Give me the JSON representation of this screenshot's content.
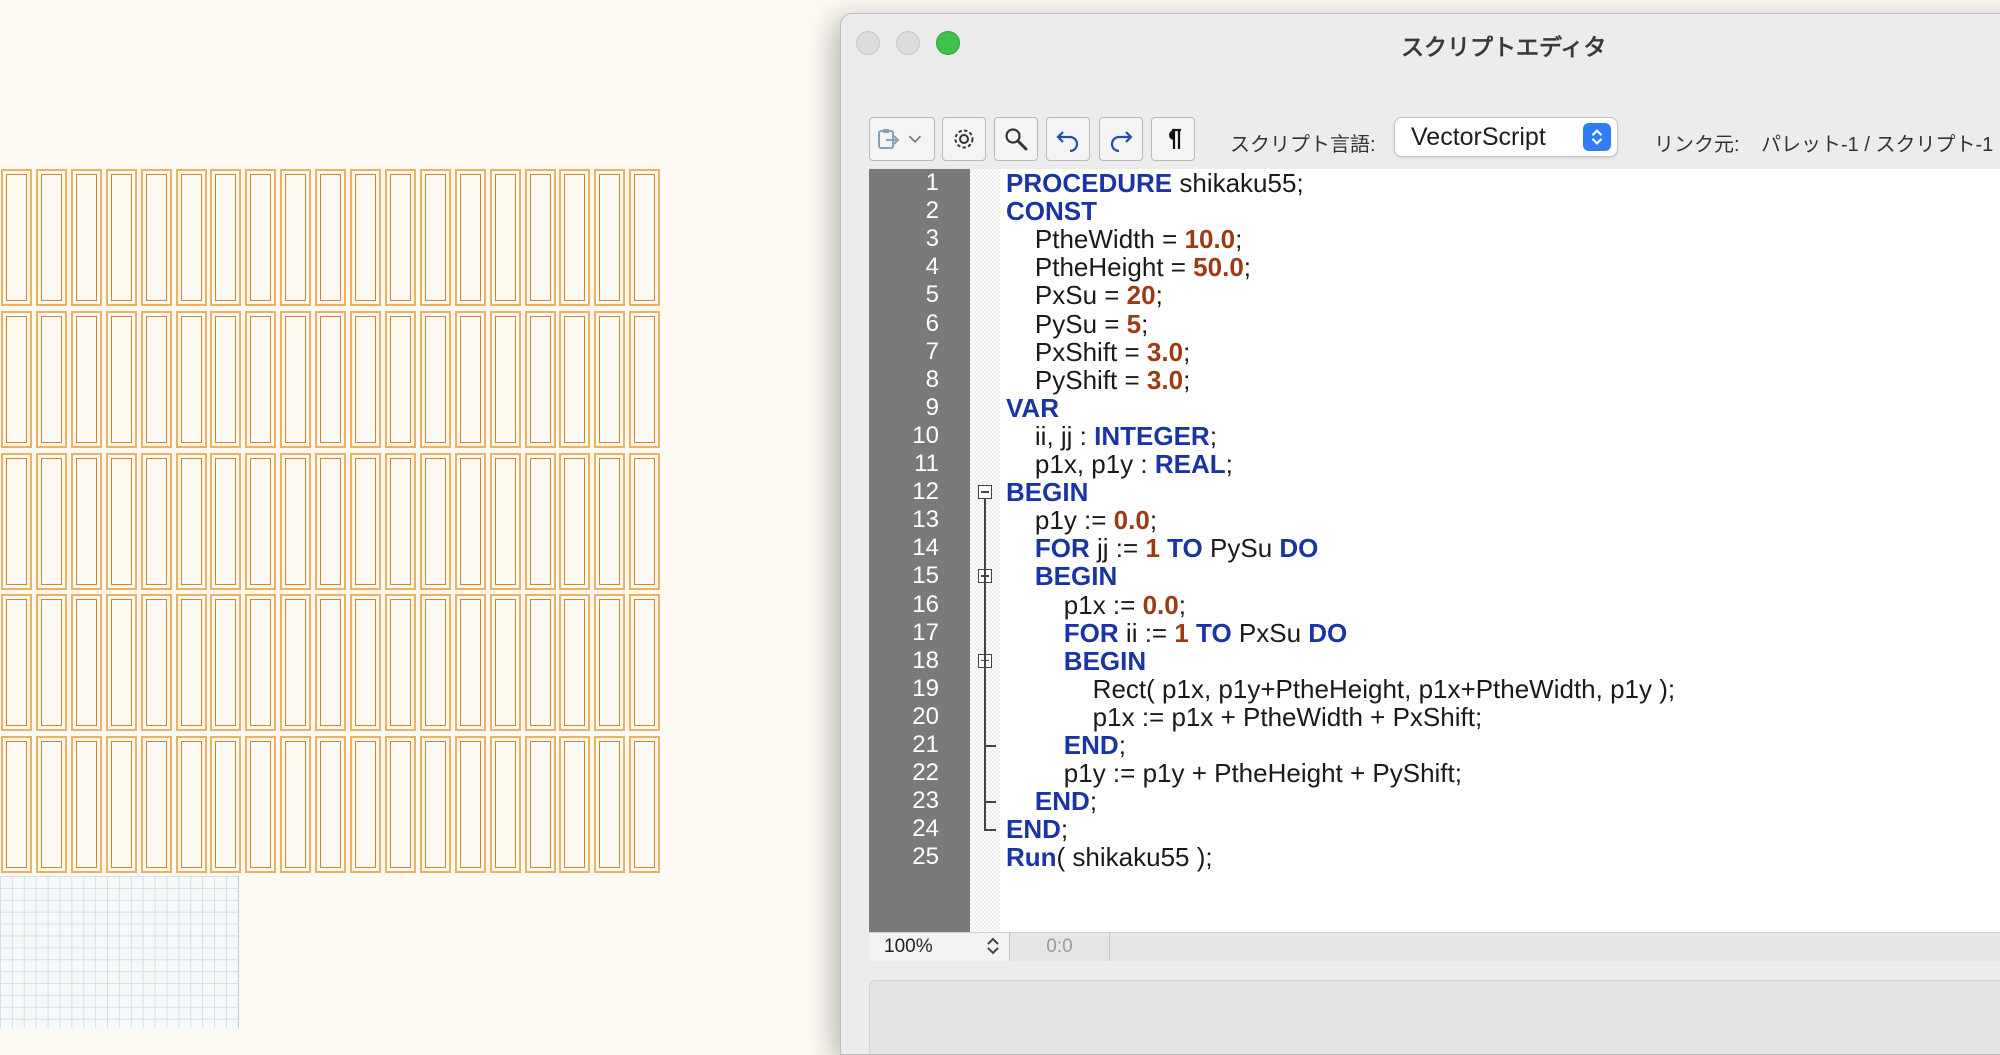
{
  "window": {
    "title": "スクリプトエディタ"
  },
  "toolbar": {
    "buttons": [
      {
        "name": "clipboard-menu-button",
        "icon": "clipboard-icon"
      },
      {
        "name": "settings-button",
        "icon": "gear-icon"
      },
      {
        "name": "find-button",
        "icon": "magnifier-icon"
      },
      {
        "name": "undo-button",
        "icon": "undo-icon"
      },
      {
        "name": "redo-button",
        "icon": "redo-icon"
      },
      {
        "name": "show-invisibles-button",
        "icon": "pilcrow-icon"
      }
    ],
    "language_label": "スクリプト言語:",
    "language_value": "VectorScript",
    "link_label": "リンク元:",
    "link_value": "パレット-1 / スクリプト-1"
  },
  "editor": {
    "lines": [
      [
        {
          "t": "PROCEDURE",
          "k": "kw"
        },
        {
          "t": " shikaku55;"
        }
      ],
      [
        {
          "t": "CONST",
          "k": "kw"
        }
      ],
      [
        {
          "t": "    PtheWidth = "
        },
        {
          "t": "10.0",
          "k": "num"
        },
        {
          "t": ";"
        }
      ],
      [
        {
          "t": "    PtheHeight = "
        },
        {
          "t": "50.0",
          "k": "num"
        },
        {
          "t": ";"
        }
      ],
      [
        {
          "t": "    PxSu = "
        },
        {
          "t": "20",
          "k": "num"
        },
        {
          "t": ";"
        }
      ],
      [
        {
          "t": "    PySu = "
        },
        {
          "t": "5",
          "k": "num"
        },
        {
          "t": ";"
        }
      ],
      [
        {
          "t": "    PxShift = "
        },
        {
          "t": "3.0",
          "k": "num"
        },
        {
          "t": ";"
        }
      ],
      [
        {
          "t": "    PyShift = "
        },
        {
          "t": "3.0",
          "k": "num"
        },
        {
          "t": ";"
        }
      ],
      [
        {
          "t": "VAR",
          "k": "kw"
        }
      ],
      [
        {
          "t": "    ii, jj : "
        },
        {
          "t": "INTEGER",
          "k": "kw"
        },
        {
          "t": ";"
        }
      ],
      [
        {
          "t": "    p1x, p1y : "
        },
        {
          "t": "REAL",
          "k": "kw"
        },
        {
          "t": ";"
        }
      ],
      [
        {
          "t": "BEGIN",
          "k": "kw"
        }
      ],
      [
        {
          "t": "    p1y := "
        },
        {
          "t": "0.0",
          "k": "num"
        },
        {
          "t": ";"
        }
      ],
      [
        {
          "t": "    "
        },
        {
          "t": "FOR",
          "k": "kw"
        },
        {
          "t": " jj := "
        },
        {
          "t": "1",
          "k": "num"
        },
        {
          "t": " "
        },
        {
          "t": "TO",
          "k": "kw"
        },
        {
          "t": " PySu "
        },
        {
          "t": "DO",
          "k": "kw"
        }
      ],
      [
        {
          "t": "    "
        },
        {
          "t": "BEGIN",
          "k": "kw"
        }
      ],
      [
        {
          "t": "        p1x := "
        },
        {
          "t": "0.0",
          "k": "num"
        },
        {
          "t": ";"
        }
      ],
      [
        {
          "t": "        "
        },
        {
          "t": "FOR",
          "k": "kw"
        },
        {
          "t": " ii := "
        },
        {
          "t": "1",
          "k": "num"
        },
        {
          "t": " "
        },
        {
          "t": "TO",
          "k": "kw"
        },
        {
          "t": " PxSu "
        },
        {
          "t": "DO",
          "k": "kw"
        }
      ],
      [
        {
          "t": "        "
        },
        {
          "t": "BEGIN",
          "k": "kw"
        }
      ],
      [
        {
          "t": "            Rect( p1x, p1y+PtheHeight, p1x+PtheWidth, p1y );"
        }
      ],
      [
        {
          "t": "            p1x := p1x + PtheWidth + PxShift;"
        }
      ],
      [
        {
          "t": "        "
        },
        {
          "t": "END",
          "k": "kw"
        },
        {
          "t": ";"
        }
      ],
      [
        {
          "t": "        p1y := p1y + PtheHeight + PyShift;"
        }
      ],
      [
        {
          "t": "    "
        },
        {
          "t": "END",
          "k": "kw"
        },
        {
          "t": ";"
        }
      ],
      [
        {
          "t": "END",
          "k": "kw"
        },
        {
          "t": ";"
        }
      ],
      [
        {
          "t": "Run",
          "k": "kw"
        },
        {
          "t": "( shikaku55 );"
        }
      ]
    ]
  },
  "status": {
    "zoom": "100%",
    "cursor": "0:0"
  },
  "drawing": {
    "columns": 19,
    "rows": 5
  }
}
